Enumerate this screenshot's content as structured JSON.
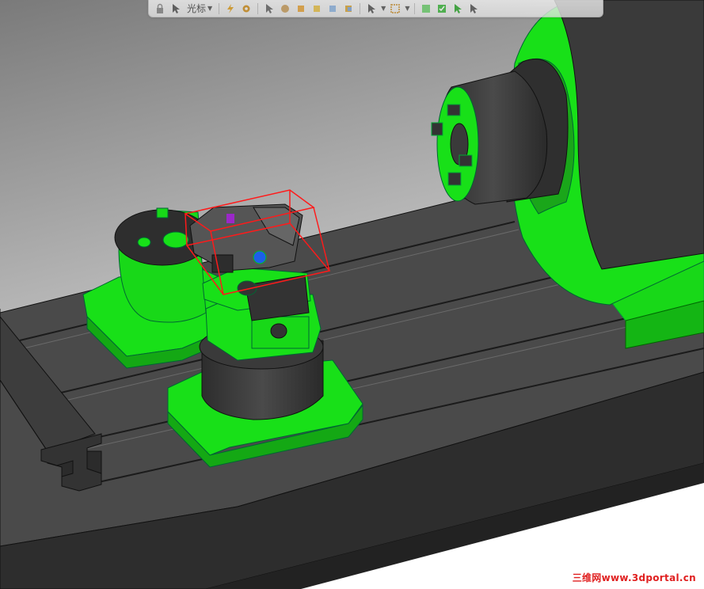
{
  "toolbar": {
    "selection_filter_label": "光标",
    "buttons": [
      "lock-icon",
      "cursor-select-icon",
      "lightning-icon",
      "gear-icon",
      "arrow-icon",
      "sphere-icon",
      "cube-orange-icon",
      "cube-yellow-icon",
      "cube-blue-icon",
      "cube-gold-icon",
      "select-arrow-icon",
      "box-select-icon",
      "green-cursor-icons"
    ]
  },
  "scene": {
    "highlight_color": "#ff1a1a",
    "part_color": "#18e018",
    "body_color": "#3c3c3c",
    "background_top": "#7e7e7e",
    "background_bottom": "#ffffff"
  },
  "watermark": {
    "text": "三维网www.3dportal.cn"
  }
}
